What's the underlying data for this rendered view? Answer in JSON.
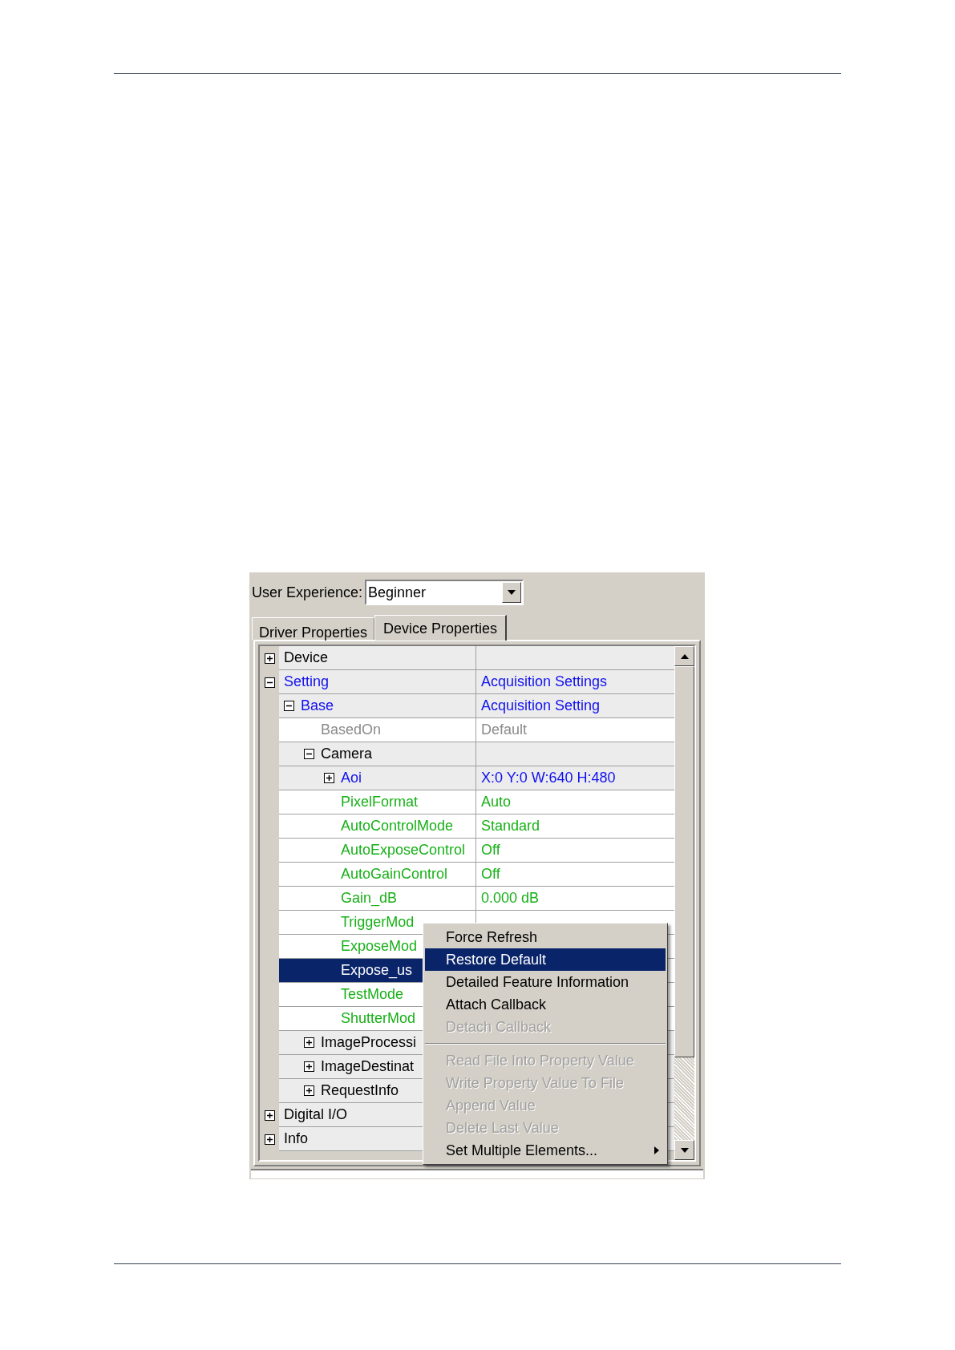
{
  "user_experience": {
    "label": "User Experience:",
    "value": "Beginner"
  },
  "tabs": [
    {
      "label": "Driver Properties",
      "selected": false
    },
    {
      "label": "Device Properties",
      "selected": true
    }
  ],
  "tree": [
    {
      "name": "Device",
      "kind": "category",
      "expanded": false,
      "selected": false
    },
    {
      "name": "Setting",
      "value": "Acquisition Settings",
      "kind": "struct",
      "expanded": true,
      "selected": false,
      "children": [
        {
          "name": "Base",
          "value": "Acquisition Setting",
          "kind": "struct",
          "expanded": true,
          "selected": false,
          "children": [
            {
              "name": "BasedOn",
              "value": "Default",
              "kind": "readonly",
              "selected": false
            },
            {
              "name": "Camera",
              "kind": "category",
              "expanded": true,
              "selected": false,
              "children": [
                {
                  "name": "Aoi",
                  "value": "X:0 Y:0 W:640 H:480",
                  "kind": "struct",
                  "expanded": false,
                  "selected": false
                },
                {
                  "name": "PixelFormat",
                  "value": "Auto",
                  "kind": "property",
                  "selected": false
                },
                {
                  "name": "AutoControlMode",
                  "value": "Standard",
                  "kind": "property",
                  "selected": false
                },
                {
                  "name": "AutoExposeControl",
                  "value": "Off",
                  "kind": "property",
                  "selected": false
                },
                {
                  "name": "AutoGainControl",
                  "value": "Off",
                  "kind": "property",
                  "selected": false
                },
                {
                  "name": "Gain_dB",
                  "value": "0.000 dB",
                  "kind": "property",
                  "selected": false
                },
                {
                  "name": "TriggerMod",
                  "kind": "property",
                  "selected": false
                },
                {
                  "name": "ExposeMod",
                  "kind": "property",
                  "selected": false
                },
                {
                  "name": "Expose_us",
                  "kind": "property",
                  "selected": true
                },
                {
                  "name": "TestMode",
                  "kind": "property",
                  "selected": false
                },
                {
                  "name": "ShutterMod",
                  "kind": "property",
                  "selected": false
                }
              ]
            },
            {
              "name": "ImageProcessi",
              "kind": "category",
              "expanded": false,
              "selected": false
            },
            {
              "name": "ImageDestinat",
              "kind": "category",
              "expanded": false,
              "selected": false
            },
            {
              "name": "RequestInfo",
              "kind": "category",
              "expanded": false,
              "selected": false
            }
          ]
        }
      ]
    },
    {
      "name": "Digital I/O",
      "kind": "category",
      "expanded": false,
      "selected": false
    },
    {
      "name": "Info",
      "kind": "category",
      "expanded": false,
      "selected": false
    }
  ],
  "context_menu": {
    "items": [
      {
        "kind": "item",
        "label": "Force Refresh",
        "disabled": false,
        "selected": false
      },
      {
        "kind": "item",
        "label": "Restore Default",
        "disabled": false,
        "selected": true
      },
      {
        "kind": "item",
        "label": "Detailed Feature Information",
        "disabled": false,
        "selected": false
      },
      {
        "kind": "item",
        "label": "Attach Callback",
        "disabled": false,
        "selected": false
      },
      {
        "kind": "item",
        "label": "Detach Callback",
        "disabled": true,
        "selected": false
      },
      {
        "kind": "separator"
      },
      {
        "kind": "item",
        "label": "Read File Into Property Value",
        "disabled": true,
        "selected": false
      },
      {
        "kind": "item",
        "label": "Write Property Value To File",
        "disabled": true,
        "selected": false
      },
      {
        "kind": "item",
        "label": "Append Value",
        "disabled": true,
        "selected": false
      },
      {
        "kind": "item",
        "label": "Delete Last Value",
        "disabled": true,
        "selected": false
      },
      {
        "kind": "submenu",
        "label": "Set Multiple Elements...",
        "disabled": false,
        "selected": false
      }
    ]
  }
}
